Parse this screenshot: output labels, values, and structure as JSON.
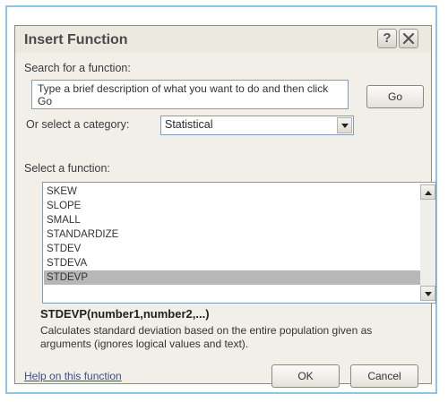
{
  "dialog": {
    "title": "Insert Function",
    "help_icon": "help-icon",
    "close_icon": "close-icon"
  },
  "search": {
    "label": "Search for a function:",
    "value": "Type a brief description of what you want to do and then click Go",
    "go_label": "Go"
  },
  "category": {
    "label": "Or select a category:",
    "selected": "Statistical"
  },
  "functions": {
    "label": "Select a function:",
    "items": [
      "SKEW",
      "SLOPE",
      "SMALL",
      "STANDARDIZE",
      "STDEV",
      "STDEVA",
      "STDEVP"
    ],
    "selected": "STDEVP"
  },
  "details": {
    "signature": "STDEVP(number1,number2,...)",
    "description": "Calculates standard deviation based on the entire population given as arguments (ignores logical values and text)."
  },
  "footer": {
    "help_link": "Help on this function",
    "ok_label": "OK",
    "cancel_label": "Cancel"
  }
}
